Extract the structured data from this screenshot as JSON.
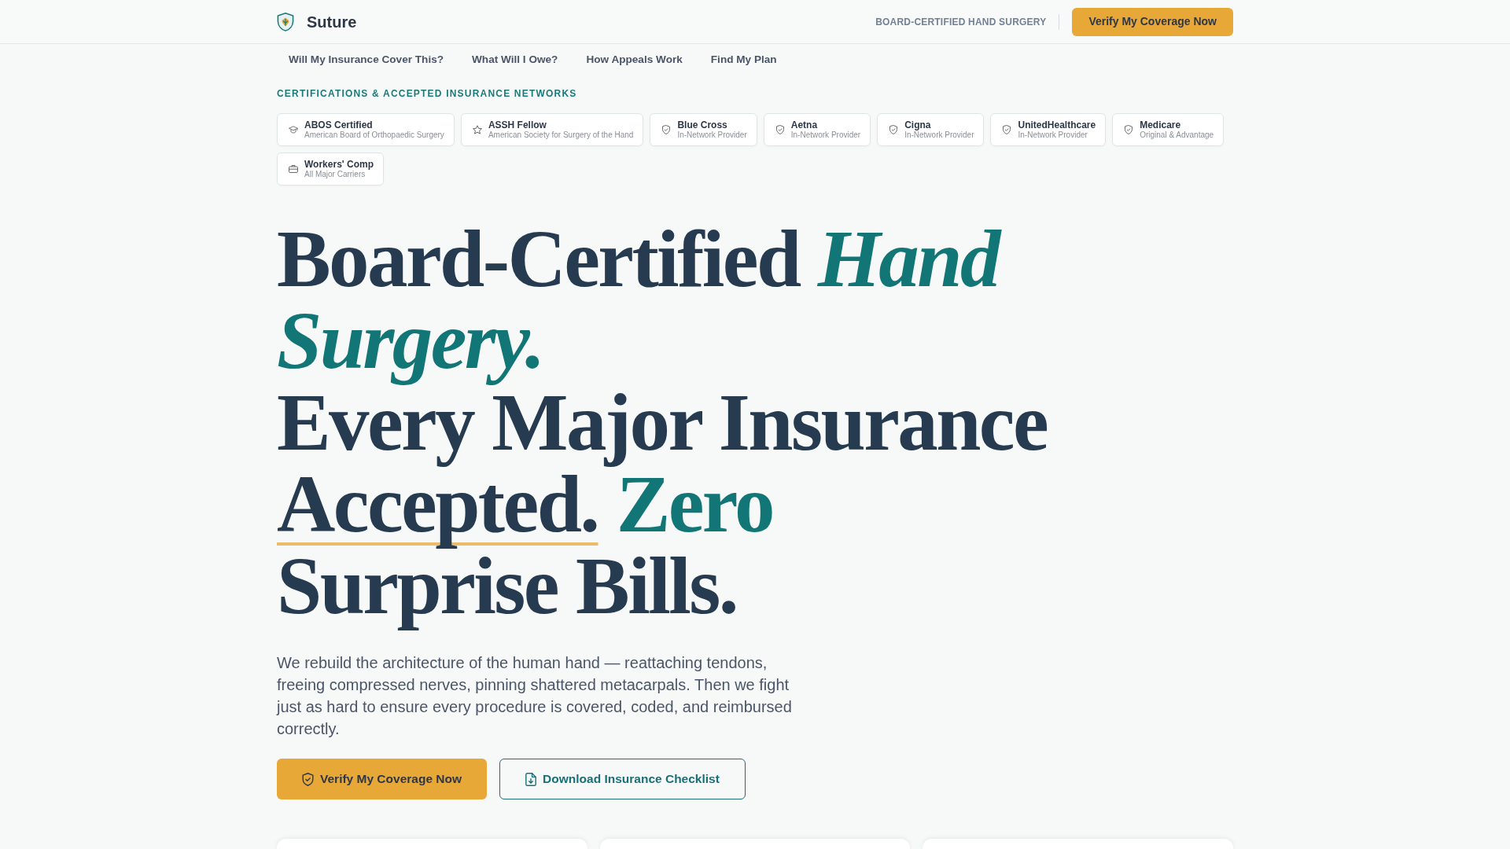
{
  "brand": {
    "name": "Suture"
  },
  "header": {
    "tagline": "BOARD-CERTIFIED HAND SURGERY",
    "cta": "Verify My Coverage Now"
  },
  "nav": [
    "Will My Insurance Cover This?",
    "What Will I Owe?",
    "How Appeals Work",
    "Find My Plan"
  ],
  "credentials": {
    "heading": "CERTIFICATIONS & ACCEPTED INSURANCE NETWORKS",
    "badges": [
      {
        "kind": "board",
        "title": "ABOS Certified",
        "subtitle": "American Board of Orthopaedic Surgery"
      },
      {
        "kind": "fellowship",
        "title": "ASSH Fellow",
        "subtitle": "American Society for Surgery of the Hand"
      },
      {
        "kind": "network",
        "title": "Blue Cross",
        "subtitle": "In-Network Provider"
      },
      {
        "kind": "network",
        "title": "Aetna",
        "subtitle": "In-Network Provider"
      },
      {
        "kind": "network",
        "title": "Cigna",
        "subtitle": "In-Network Provider"
      },
      {
        "kind": "network",
        "title": "UnitedHealthcare",
        "subtitle": "In-Network Provider"
      },
      {
        "kind": "network",
        "title": "Medicare",
        "subtitle": "Original & Advantage"
      },
      {
        "kind": "comp",
        "title": "Workers' Comp",
        "subtitle": "All Major Carriers"
      }
    ]
  },
  "hero": {
    "headline": [
      [
        {
          "kind": "plain",
          "text": "Board-Certified"
        },
        {
          "kind": "accent_italic",
          "text": "Hand Surgery."
        }
      ],
      [
        {
          "kind": "plain",
          "text": "Every Major Insurance"
        },
        {
          "kind": "underlined",
          "text": "Accepted."
        },
        {
          "kind": "accent",
          "text": "Zero"
        },
        {
          "kind": "plain",
          "text": "Surprise Bills."
        }
      ]
    ],
    "lede": "We rebuild the architecture of the human hand — reattaching tendons, freeing compressed nerves, pinning shattered metacarpals. Then we fight just as hard to ensure every procedure is covered, coded, and reimbursed correctly.",
    "buttons": [
      {
        "kind": "primary",
        "label": "Verify My Coverage Now"
      },
      {
        "kind": "outline",
        "label": "Download Insurance Checklist"
      }
    ]
  }
}
